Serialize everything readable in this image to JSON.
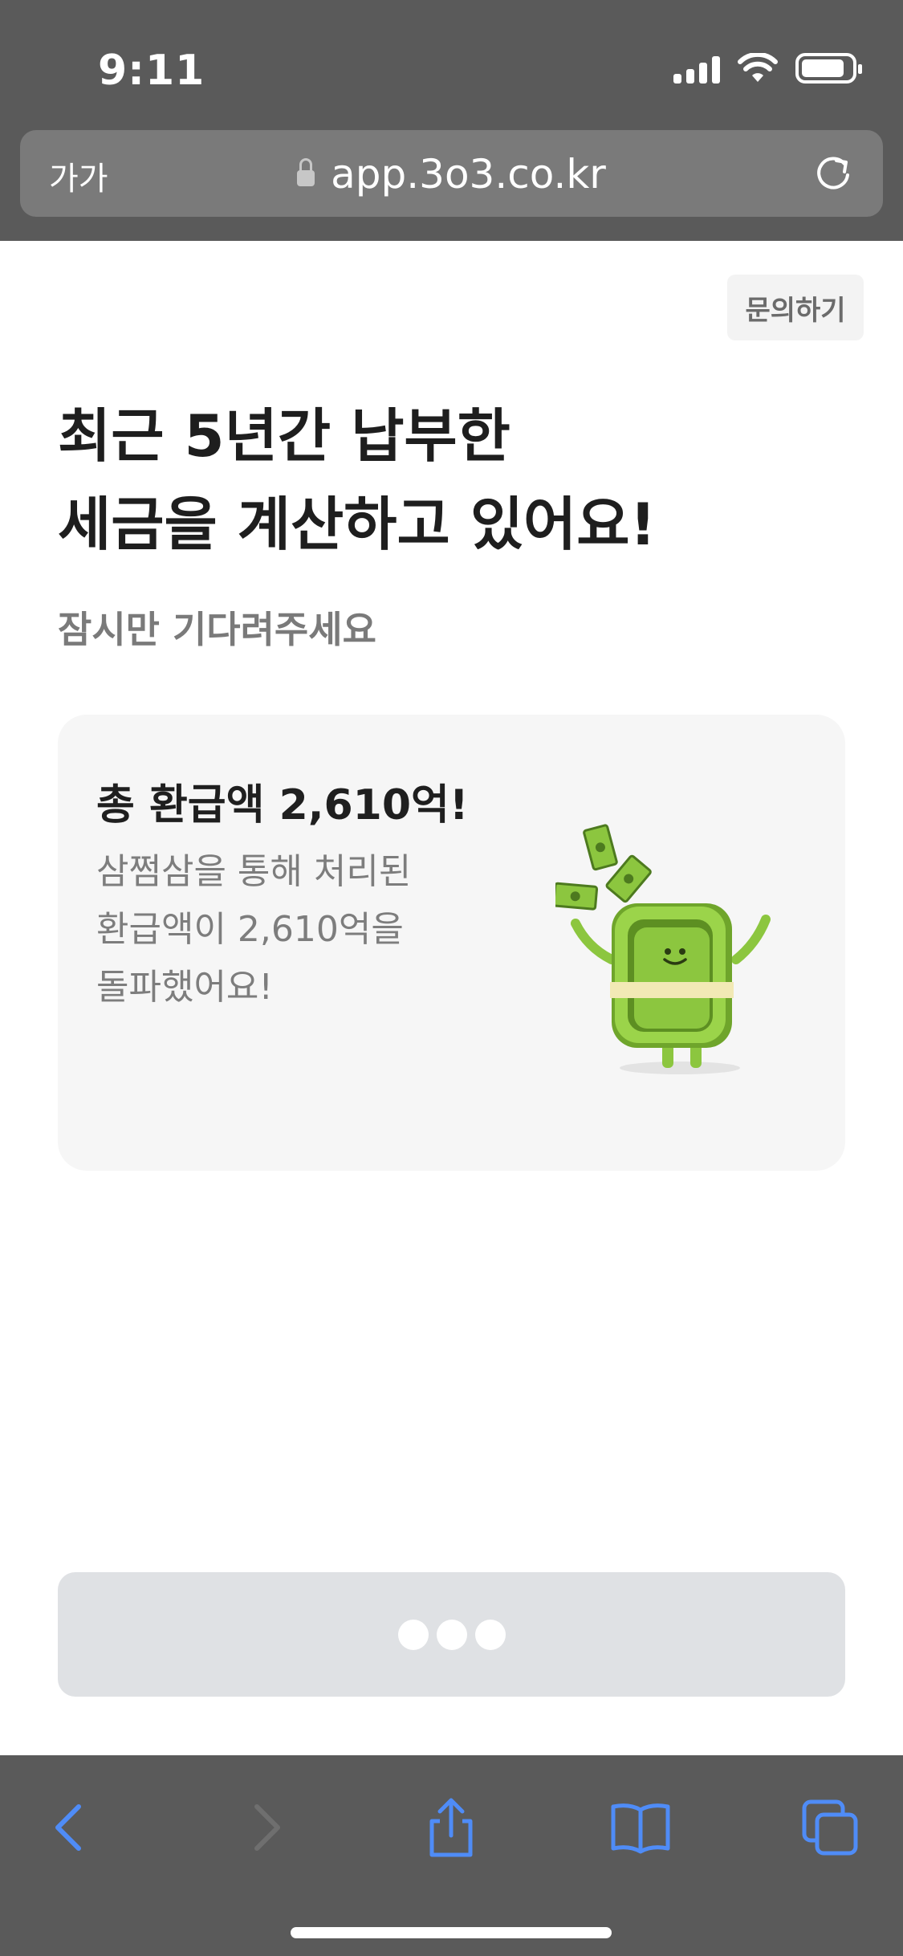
{
  "status_bar": {
    "time": "9:11"
  },
  "browser": {
    "text_size_label": "가가",
    "url": "app.3o3.co.kr"
  },
  "header": {
    "inquiry_label": "문의하기"
  },
  "main": {
    "headline_line1": "최근 5년간 납부한",
    "headline_line2": "세금을 계산하고 있어요!",
    "subtitle": "잠시만 기다려주세요"
  },
  "card": {
    "title": "총 환급액 2,610억!",
    "desc_line1": "삼쩜삼을 통해 처리된",
    "desc_line2": "환급액이 2,610억을",
    "desc_line3": "돌파했어요!"
  },
  "colors": {
    "chrome_bg": "#5a5a5a",
    "accent_blue": "#4f8cf7",
    "mascot_green": "#8cc63f",
    "loading_button_bg": "#dfe1e4"
  },
  "icons": {
    "lock": "lock-icon",
    "reload": "reload-icon",
    "back": "back-icon",
    "forward": "forward-icon",
    "share": "share-icon",
    "bookmarks": "bookmarks-icon",
    "tabs": "tabs-icon"
  }
}
